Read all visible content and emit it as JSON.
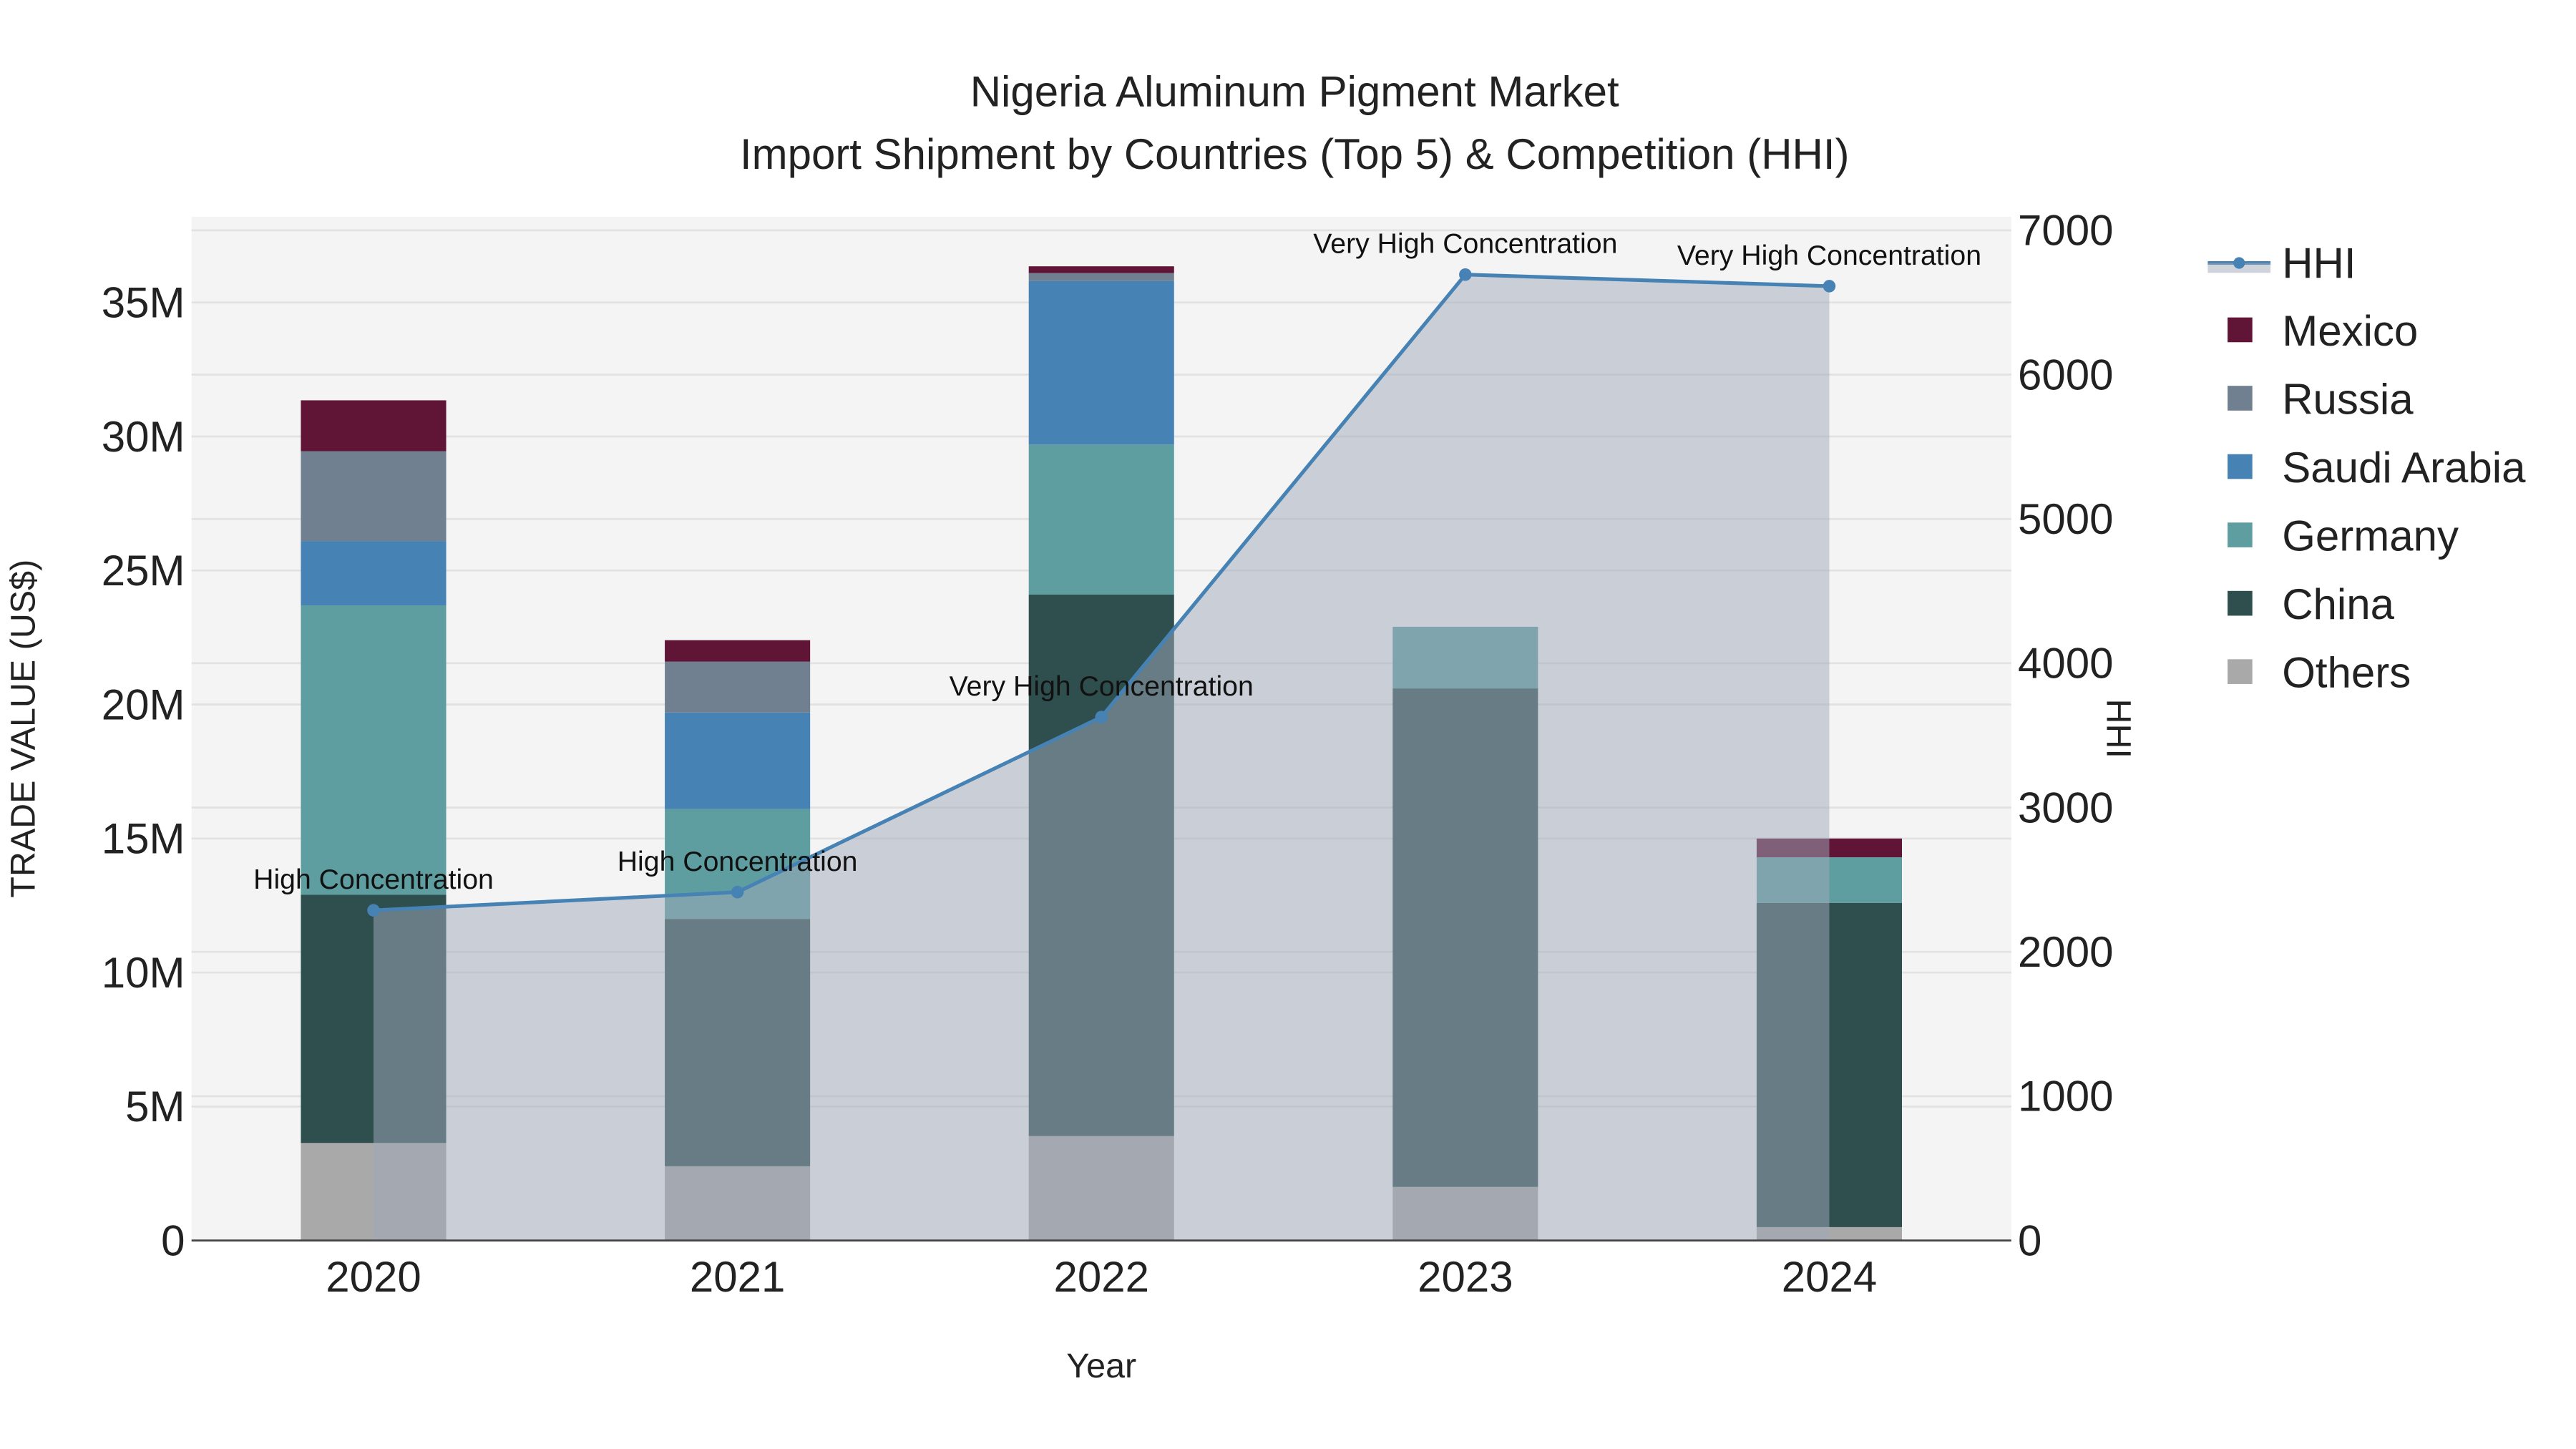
{
  "chart_data": {
    "type": "bar",
    "title": "Nigeria Aluminum Pigment Market",
    "subtitle": "Import Shipment by Countries (Top 5) & Competition (HHI)",
    "xlabel": "Year",
    "ylabel": "TRADE VALUE (US$)",
    "y2label": "HHI",
    "categories": [
      "2020",
      "2021",
      "2022",
      "2023",
      "2024"
    ],
    "ylim": [
      0,
      38200000
    ],
    "y2lim": [
      0,
      7094
    ],
    "yticks": [
      0,
      5000000,
      10000000,
      15000000,
      20000000,
      25000000,
      30000000,
      35000000
    ],
    "ytick_labels": [
      "0",
      "5M",
      "10M",
      "15M",
      "20M",
      "25M",
      "30M",
      "35M"
    ],
    "y2ticks": [
      0,
      1000,
      2000,
      3000,
      4000,
      5000,
      6000,
      7000
    ],
    "y2tick_labels": [
      "0",
      "1000",
      "2000",
      "3000",
      "4000",
      "5000",
      "6000",
      "7000"
    ],
    "grid": true,
    "legend_position": "right",
    "series": [
      {
        "name": "Others",
        "color": "#a9a9a9",
        "values": [
          3640000,
          2770000,
          3900000,
          2000000,
          500000
        ]
      },
      {
        "name": "China",
        "color": "#2f4f4f",
        "values": [
          9260000,
          9230000,
          20200000,
          18600000,
          12100000
        ]
      },
      {
        "name": "Germany",
        "color": "#5f9ea0",
        "values": [
          10800000,
          4100000,
          5600000,
          2300000,
          1700000
        ]
      },
      {
        "name": "Saudi Arabia",
        "color": "#4682b4",
        "values": [
          2400000,
          3600000,
          6100000,
          0,
          0
        ]
      },
      {
        "name": "Russia",
        "color": "#708090",
        "values": [
          3350000,
          1900000,
          300000,
          0,
          0
        ]
      },
      {
        "name": "Mexico",
        "color": "#601436",
        "values": [
          1900000,
          800000,
          250000,
          0,
          700000
        ]
      }
    ],
    "hhi": {
      "name": "HHI",
      "color": "#4682b4",
      "values": [
        2288,
        2414,
        3627,
        6693,
        6613
      ],
      "annotations": [
        "High Concentration",
        "High Concentration",
        "Very High Concentration",
        "Very High Concentration",
        "Very High Concentration"
      ]
    }
  }
}
